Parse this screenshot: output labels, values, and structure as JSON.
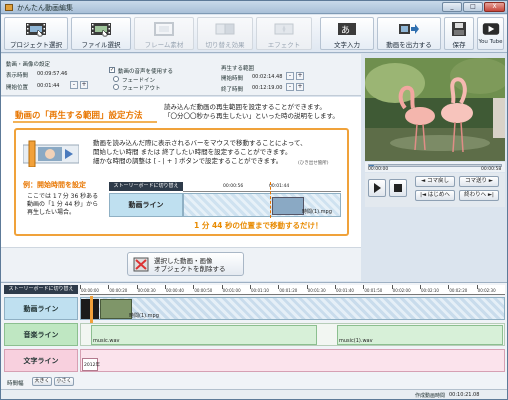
{
  "window": {
    "title": "かんたん動画編集",
    "controls": {
      "minimize": "_",
      "maximize": "□",
      "close": "X"
    }
  },
  "toolbar": {
    "buttons": [
      {
        "label": "プロジェクト選択",
        "icon": "film-strip-icon",
        "enabled": true
      },
      {
        "label": "ファイル選択",
        "icon": "film-strip-icon",
        "enabled": true
      },
      {
        "label": "フレーム素材",
        "icon": "frame-icon",
        "enabled": false
      },
      {
        "label": "切り替え効果",
        "icon": "transition-icon",
        "enabled": false
      },
      {
        "label": "エフェクト",
        "icon": "effect-icon",
        "enabled": false
      },
      {
        "label": "文字入力",
        "icon": "text-icon",
        "enabled": true
      },
      {
        "label": "動画を出力する",
        "icon": "export-icon",
        "enabled": true
      },
      {
        "label": "保存",
        "icon": "floppy-icon",
        "enabled": true
      },
      {
        "label": "You Tube",
        "icon": "youtube-icon",
        "enabled": true
      }
    ]
  },
  "settings": {
    "section_label": "動画・画像の設定",
    "display_time_label": "表示時間",
    "display_time_value": "00:09:57.46",
    "start_pos_label": "開始位置",
    "start_pos_value": "00:01:44",
    "audio_use_label": "動画の音声を使用する",
    "fade_in_label": "フェードイン",
    "fade_out_label": "フェードアウト",
    "range_label": "再生する範囲",
    "range_start_label": "開始時間",
    "range_start_value": "00:02:14.48",
    "range_end_label": "終了時間",
    "range_end_value": "00:12:19.00",
    "spin_minus": "-",
    "spin_plus": "+"
  },
  "help": {
    "title": "動画の「再生する範囲」設定方法",
    "intro_line1": "読み込んだ動画の再生範囲を設定することができます。",
    "intro_line2": "「〇分〇〇秒から再生したい」といった時の説明をします。",
    "body_line1": "動画を読み込んだ際に表示されるバーをマウスで移動することによって、",
    "body_line2": "開始したい時間 または 終了したい時間を設定することができます。",
    "body_line3": "細かな時間の調整は [ - | + ] ボタンで設定することができます。",
    "example_title": "例：開始時間を設定",
    "example_line1": "ここでは 1７分 36 秒ある",
    "example_line2": "動画の「1 分 44 秒」から",
    "example_line3": "再生したい場合。",
    "mini_storyboard_label": "ストーリーボードに切り替え",
    "mini_track_label": "動画ライン",
    "mini_ruler": [
      "00:00:56",
      "00:01:44"
    ],
    "mini_clip_label": "時間(1).mpg",
    "note": "1 分 44 秒の位置まで移動するだけ！",
    "small_tag": "(ひき出せ箇所)"
  },
  "delete_button": {
    "line1": "選択した動画・画像",
    "line2": "オブジェクトを削除する"
  },
  "preview": {
    "time_start": "00:00:00",
    "time_end": "00:00:58",
    "seek_progress": 0.04
  },
  "playback": {
    "prev_frame": "◄ コマ戻し",
    "next_frame": "コマ送り ►",
    "to_start": "|◄ はじめへ",
    "to_end": "終わりへ ►|"
  },
  "timeline": {
    "storyboard_button": "ストーリーボードに切り替え",
    "ruler_labels": [
      "00:00:00",
      "00:00:20",
      "00:00:30",
      "00:00:40",
      "00:00:50",
      "00:01:00",
      "00:01:10",
      "00:01:20",
      "00:01:30",
      "00:01:40",
      "00:01:50",
      "00:02:00",
      "00:02:10",
      "00:02:20",
      "00:02:30"
    ],
    "tracks": {
      "video": {
        "label": "動画ライン",
        "clip": "時間(1).mpg"
      },
      "music": {
        "label": "音楽ライン",
        "clip1": "music.wav",
        "clip2": "music(1).wav"
      },
      "text": {
        "label": "文字ライン",
        "clip": "2012年"
      }
    },
    "zoom_label": "時間幅",
    "zoom_in": "大きく",
    "zoom_out": "小さく"
  },
  "status": {
    "label": "作成動画時間",
    "value": "00:10:21.08"
  },
  "colors": {
    "accent_orange": "#e87600",
    "track_video_bg": "#bfe0f0",
    "track_music_bg": "#bfe7c2",
    "track_text_bg": "#f8d0de"
  }
}
